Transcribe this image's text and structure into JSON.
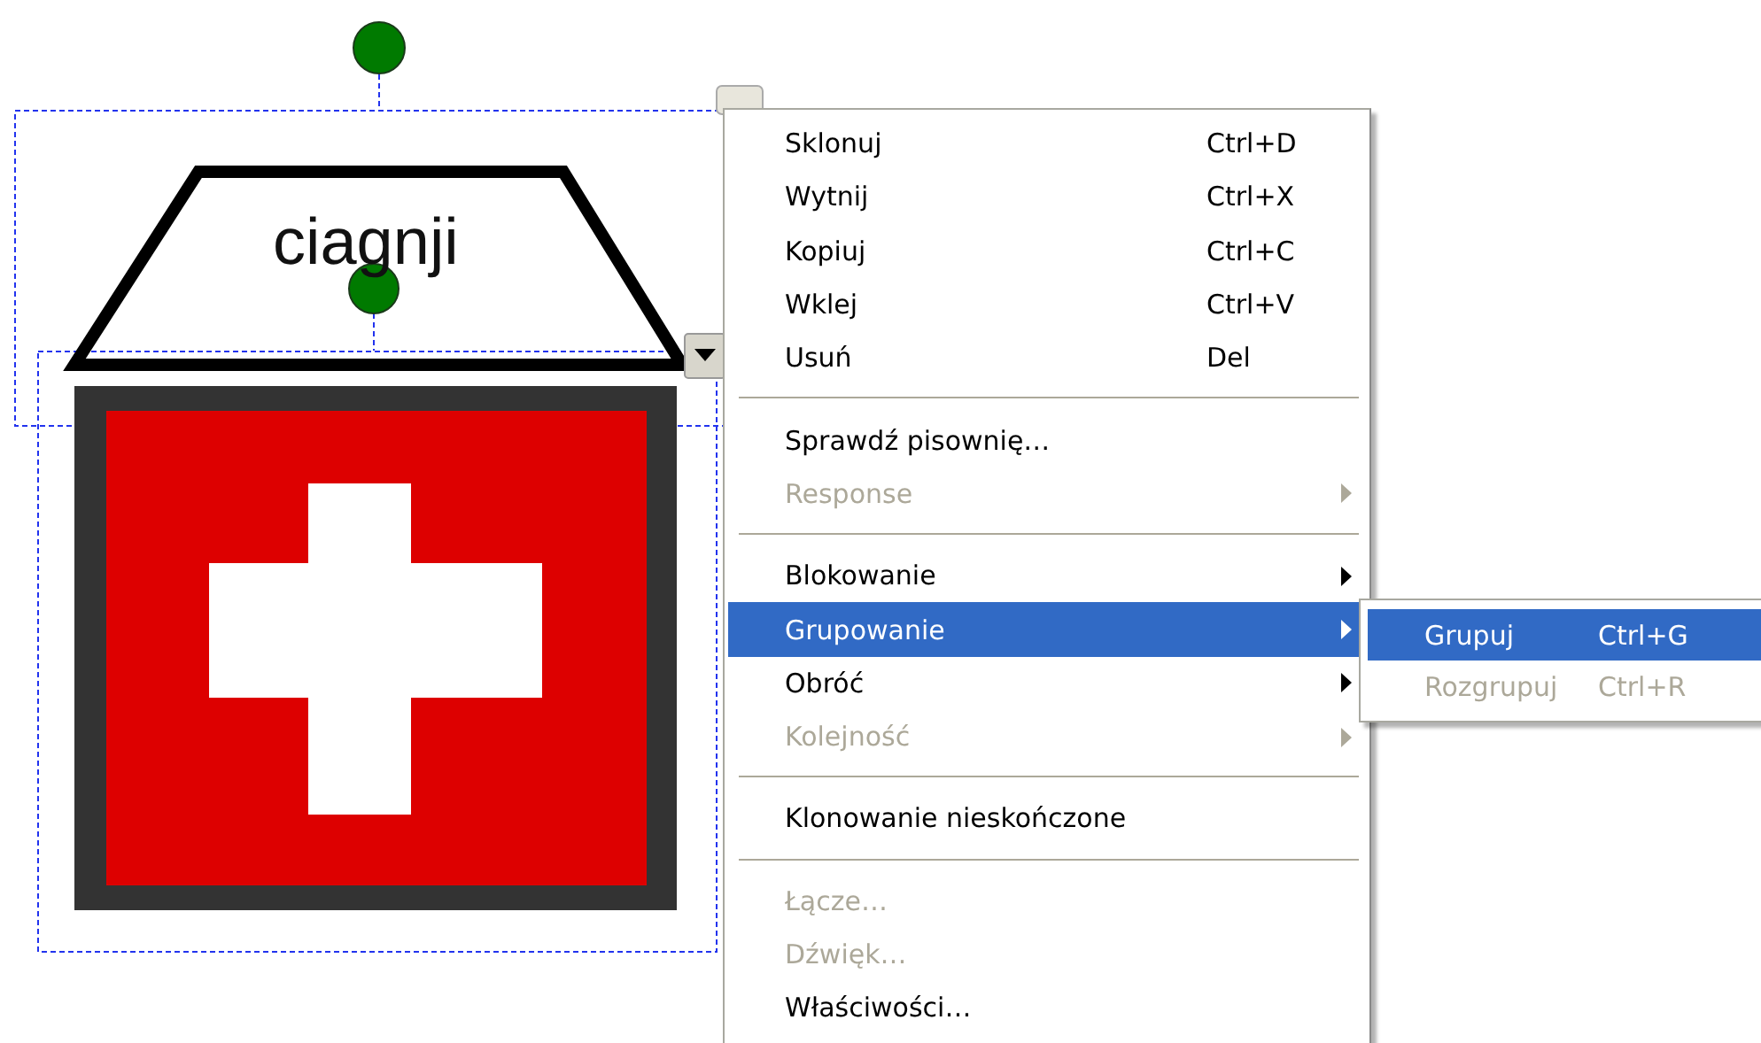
{
  "canvas": {
    "shape_text": "ciagnji"
  },
  "context_menu": {
    "items": [
      {
        "kind": "item",
        "label": "Sklonuj",
        "shortcut": "Ctrl+D",
        "disabled": false,
        "selected": false,
        "submenu": false
      },
      {
        "kind": "item",
        "label": "Wytnij",
        "shortcut": "Ctrl+X",
        "disabled": false,
        "selected": false,
        "submenu": false
      },
      {
        "kind": "item",
        "label": "Kopiuj",
        "shortcut": "Ctrl+C",
        "disabled": false,
        "selected": false,
        "submenu": false
      },
      {
        "kind": "item",
        "label": "Wklej",
        "shortcut": "Ctrl+V",
        "disabled": false,
        "selected": false,
        "submenu": false
      },
      {
        "kind": "item",
        "label": "Usuń",
        "shortcut": "Del",
        "disabled": false,
        "selected": false,
        "submenu": false
      },
      {
        "kind": "separator"
      },
      {
        "kind": "item",
        "label": "Sprawdź pisownię…",
        "disabled": false,
        "selected": false,
        "submenu": false
      },
      {
        "kind": "item",
        "label": "Response",
        "disabled": true,
        "selected": false,
        "submenu": true
      },
      {
        "kind": "separator"
      },
      {
        "kind": "item",
        "label": "Blokowanie",
        "disabled": false,
        "selected": false,
        "submenu": true
      },
      {
        "kind": "item",
        "label": "Grupowanie",
        "disabled": false,
        "selected": true,
        "submenu": true
      },
      {
        "kind": "item",
        "label": "Obróć",
        "disabled": false,
        "selected": false,
        "submenu": true
      },
      {
        "kind": "item",
        "label": "Kolejność",
        "disabled": true,
        "selected": false,
        "submenu": true
      },
      {
        "kind": "separator"
      },
      {
        "kind": "item",
        "label": "Klonowanie nieskończone",
        "disabled": false,
        "selected": false,
        "submenu": false
      },
      {
        "kind": "separator"
      },
      {
        "kind": "item",
        "label": "Łącze…",
        "disabled": true,
        "selected": false,
        "submenu": false
      },
      {
        "kind": "item",
        "label": "Dźwięk…",
        "disabled": true,
        "selected": false,
        "submenu": false
      },
      {
        "kind": "item",
        "label": "Właściwości…",
        "disabled": false,
        "selected": false,
        "submenu": false
      }
    ]
  },
  "submenu": {
    "items": [
      {
        "label": "Grupuj",
        "shortcut": "Ctrl+G",
        "disabled": false,
        "selected": true
      },
      {
        "label": "Rozgrupuj",
        "shortcut": "Ctrl+R",
        "disabled": true,
        "selected": false
      }
    ]
  }
}
